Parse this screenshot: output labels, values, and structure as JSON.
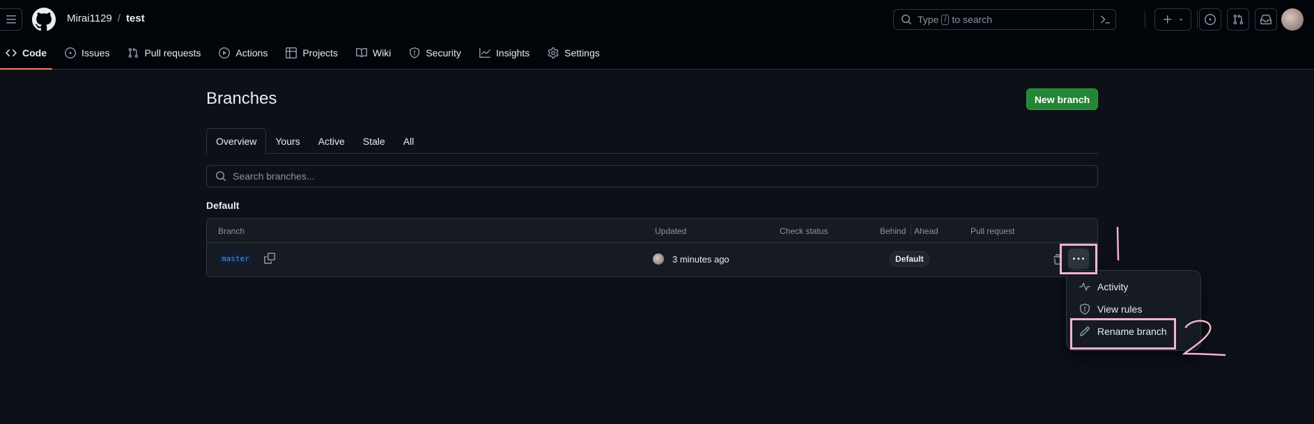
{
  "repo": {
    "owner": "Mirai1129",
    "separator": "/",
    "name": "test"
  },
  "search": {
    "prefix": "Type",
    "key": "/",
    "suffix": "to search"
  },
  "nav": [
    {
      "label": "Code",
      "icon": "code-icon",
      "active": true
    },
    {
      "label": "Issues",
      "icon": "issue-icon"
    },
    {
      "label": "Pull requests",
      "icon": "pull-request-icon"
    },
    {
      "label": "Actions",
      "icon": "play-icon"
    },
    {
      "label": "Projects",
      "icon": "table-icon"
    },
    {
      "label": "Wiki",
      "icon": "book-icon"
    },
    {
      "label": "Security",
      "icon": "shield-icon"
    },
    {
      "label": "Insights",
      "icon": "graph-icon"
    },
    {
      "label": "Settings",
      "icon": "gear-icon"
    }
  ],
  "page": {
    "title": "Branches",
    "new_branch_label": "New branch"
  },
  "tabs": [
    "Overview",
    "Yours",
    "Active",
    "Stale",
    "All"
  ],
  "branch_search": {
    "placeholder": "Search branches..."
  },
  "section": {
    "label": "Default"
  },
  "table": {
    "headers": {
      "branch": "Branch",
      "updated": "Updated",
      "check_status": "Check status",
      "behind": "Behind",
      "ahead": "Ahead",
      "pull_request": "Pull request"
    },
    "rows": [
      {
        "branch": "master",
        "updated": "3 minutes ago",
        "badge": "Default"
      }
    ]
  },
  "menu": [
    {
      "label": "Activity",
      "icon": "pulse-icon"
    },
    {
      "label": "View rules",
      "icon": "shield-icon"
    },
    {
      "label": "Rename branch",
      "icon": "pencil-icon"
    }
  ],
  "annotations": {
    "first": "1",
    "second": "2",
    "color": "#f3b4cc"
  },
  "colors": {
    "background": "#0d1117",
    "header": "#010409",
    "primary_button": "#238636",
    "link": "#4493f8",
    "active_tab_underline": "#f78166"
  }
}
